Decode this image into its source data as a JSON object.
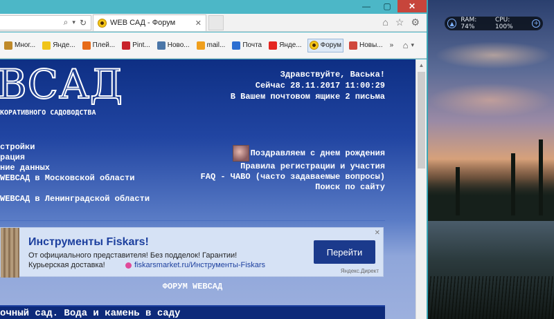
{
  "browser": {
    "tab_title": "WEB САД - Форум",
    "window_controls": {
      "minimize": "—",
      "maximize": "▢",
      "close": "✕"
    }
  },
  "favorites": [
    {
      "label": "Мног...",
      "icon": "person-icon",
      "color": "#c08a2a"
    },
    {
      "label": "Янде...",
      "icon": "yandex-star-icon",
      "color": "#f0c419"
    },
    {
      "label": "Плей...",
      "icon": "player-icon",
      "color": "#e76b18"
    },
    {
      "label": "Pint...",
      "icon": "pinterest-icon",
      "color": "#c8232c"
    },
    {
      "label": "Ново...",
      "icon": "vk-icon",
      "color": "#4a76a8"
    },
    {
      "label": "mail...",
      "icon": "mail-at-icon",
      "color": "#f09f1d"
    },
    {
      "label": "Почта",
      "icon": "envelope-icon",
      "color": "#2d6fd1"
    },
    {
      "label": "Янде...",
      "icon": "yandex-y-icon",
      "color": "#e52620"
    },
    {
      "label": "Форум",
      "icon": "sunflower-icon",
      "color": "#f2c418"
    },
    {
      "label": "Новы...",
      "icon": "news-icon",
      "color": "#d0483c"
    }
  ],
  "system_monitor": {
    "ram": "RAM: 74%",
    "cpu": "CPU: 100%"
  },
  "site": {
    "logo": "ВСАД",
    "tagline": "КОРАТИВНОГО САДОВОДСТВА",
    "greeting": {
      "hello": "Здравствуйте, Васька!",
      "now": "Сейчас 28.11.2017 11:00:29",
      "mail": "В Вашем почтовом ящике 2 письма"
    },
    "left_menu": [
      "стройки",
      "рация",
      "ние данных",
      "WEBCAД в Московской области",
      "WEBCAД в Ленинградской области"
    ],
    "right_menu": {
      "birthday": "Поздравляем с днем рождения",
      "rules": "Правила регистрации и участия",
      "faq": "FAQ - ЧАВО (часто задаваемые вопросы)",
      "search": "Поиск по сайту"
    },
    "forum_title": "ФОРУМ WEBCAД",
    "section_title": "очный сад. Вода и камень в саду"
  },
  "ad": {
    "title": "Инструменты Fiskars!",
    "line1": "От официального представителя! Без подделок! Гарантии!",
    "line2": "Курьерская доставка!",
    "link": "fiskarsmarket.ru/Инструменты-Fiskars",
    "button": "Перейти",
    "source": "Яндекс.Директ",
    "close": "✕"
  }
}
